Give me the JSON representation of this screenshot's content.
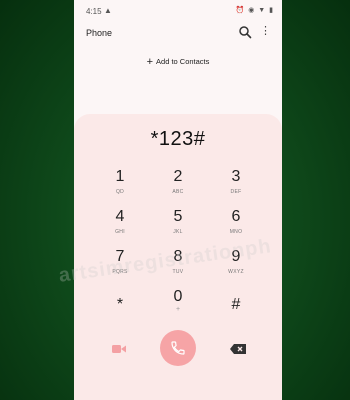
{
  "status_bar": {
    "time": "4:15",
    "warning": "▲",
    "icons": "⏰ ◉ ▼ ▮"
  },
  "header": {
    "title": "Phone",
    "search_icon": "search-icon",
    "more_icon": "more-vert-icon",
    "more_glyph": "⋮"
  },
  "add_contacts": {
    "plus": "+",
    "label": "Add to Contacts"
  },
  "dialer": {
    "entered": "*123#",
    "keys": [
      {
        "digit": "1",
        "letters": "QD"
      },
      {
        "digit": "2",
        "letters": "ABC"
      },
      {
        "digit": "3",
        "letters": "DEF"
      },
      {
        "digit": "4",
        "letters": "GHI"
      },
      {
        "digit": "5",
        "letters": "JKL"
      },
      {
        "digit": "6",
        "letters": "MNO"
      },
      {
        "digit": "7",
        "letters": "PQRS"
      },
      {
        "digit": "8",
        "letters": "TUV"
      },
      {
        "digit": "9",
        "letters": "WXYZ"
      },
      {
        "digit": "*",
        "letters": ""
      },
      {
        "digit": "0",
        "letters": "+"
      },
      {
        "digit": "#",
        "letters": ""
      }
    ]
  },
  "bottom": {
    "video_icon": "video-call-icon",
    "call_icon": "phone-icon",
    "backspace_icon": "backspace-icon"
  },
  "watermark": "artsimregistrationph",
  "colors": {
    "background": "#0f4a1b",
    "pad": "#fbe9e8",
    "call_button": "#f6a4a6",
    "accent_icon": "#f4a0a3"
  }
}
